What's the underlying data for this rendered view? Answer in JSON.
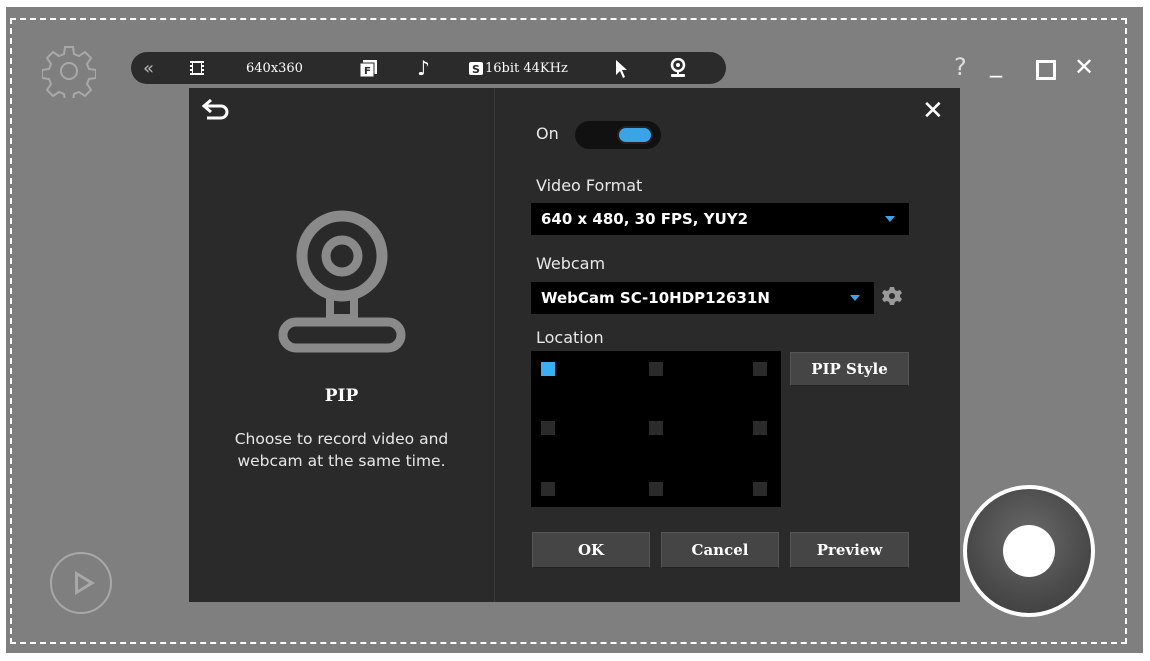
{
  "toolbar": {
    "resolution": "640x360",
    "audio_format": "16bit 44KHz",
    "icons": [
      "collapse-icon",
      "film-icon",
      "fps-icon",
      "music-note-icon",
      "sound-icon",
      "cursor-icon",
      "webcam-icon"
    ]
  },
  "window_controls": {
    "help": "?",
    "minimize": "_",
    "maximize": "☐",
    "close": "✕"
  },
  "pip": {
    "title": "PIP",
    "description_line1": "Choose to record video and",
    "description_line2": "webcam at the same time."
  },
  "settings": {
    "on_label": "On",
    "toggle_on": true,
    "video_format_label": "Video Format",
    "video_format_value": "640 x 480, 30 FPS, YUY2",
    "webcam_label": "Webcam",
    "webcam_value": "WebCam SC-10HDP12631N",
    "location_label": "Location",
    "selected_location": "top-left",
    "pip_style_label": "PIP Style"
  },
  "buttons": {
    "ok": "OK",
    "cancel": "Cancel",
    "preview": "Preview"
  },
  "colors": {
    "accent": "#3aa4e6",
    "panel": "#2a2a2a",
    "background": "#7f7f7f"
  }
}
